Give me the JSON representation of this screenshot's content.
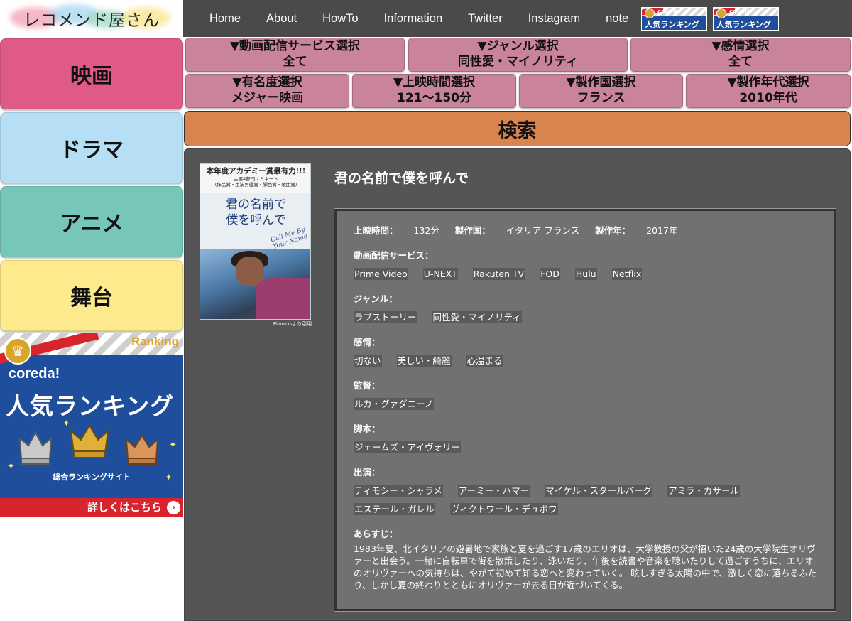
{
  "logo": {
    "text": "レコメンド屋さん"
  },
  "nav": {
    "links": [
      "Home",
      "About",
      "HowTo",
      "Information",
      "Twitter",
      "Instagram",
      "note"
    ],
    "banner_brand": "coreda!",
    "banner_title": "人気ランキング"
  },
  "sidebar": {
    "items": [
      "映画",
      "ドラマ",
      "アニメ",
      "舞台"
    ],
    "colors": [
      "#df5a86",
      "#b6def5",
      "#76c6ba",
      "#fcea8c"
    ]
  },
  "ranking_banner": {
    "ranking_label": "Ranking",
    "brand": "coreda!",
    "title": "人気ランキング",
    "subtitle": "総合ランキングサイト",
    "more": "詳しくはこちら",
    "crown_icon": "crown-icon"
  },
  "filters": [
    {
      "label": "▼動画配信サービス選択",
      "value": "全て"
    },
    {
      "label": "▼ジャンル選択",
      "value": "同性愛・マイノリティ"
    },
    {
      "label": "▼感情選択",
      "value": "全て"
    },
    {
      "label": "▼有名度選択",
      "value": "メジャー映画"
    },
    {
      "label": "▼上映時間選択",
      "value": "121〜150分"
    },
    {
      "label": "▼製作国選択",
      "value": "フランス"
    },
    {
      "label": "▼製作年代選択",
      "value": "2010年代"
    }
  ],
  "search": {
    "label": "検索",
    "color": "#d9844c"
  },
  "movie": {
    "title": "君の名前で僕を呼んで",
    "poster": {
      "top_text_1": "本年度アカデミー賞最有力!!!",
      "top_text_2": "主要4部門ノミネート",
      "top_text_3": "(作品賞・主演男優賞・脚色賞・歌曲賞)",
      "title_line_1": "君の名前で",
      "title_line_2": "僕を呼んで",
      "sub_title": "Call Me By Your Name",
      "credit": "Filmarksより引用"
    },
    "meta": {
      "runtime_label": "上映時間：",
      "runtime_value": "132分",
      "country_label": "製作国：",
      "country_value": "イタリア フランス",
      "year_label": "製作年：",
      "year_value": "2017年"
    },
    "sections": {
      "streaming_label": "動画配信サービス：",
      "streaming": [
        "Prime Video",
        "U-NEXT",
        "Rakuten TV",
        "FOD",
        "Hulu",
        "Netflix"
      ],
      "genre_label": "ジャンル：",
      "genre": [
        "ラブストーリー",
        "同性愛・マイノリティ"
      ],
      "emotion_label": "感情：",
      "emotion": [
        "切ない",
        "美しい・綺麗",
        "心温まる"
      ],
      "director_label": "監督：",
      "director": [
        "ルカ・グァダニーノ"
      ],
      "writer_label": "脚本：",
      "writer": [
        "ジェームズ・アイヴォリー"
      ],
      "cast_label": "出演：",
      "cast": [
        "ティモシー・シャラメ",
        "アーミー・ハマー",
        "マイケル・スタールバーグ",
        "アミラ・カサール",
        "エステール・ガレル",
        "ヴィクトワール・デュボワ"
      ],
      "synopsis_label": "あらすじ：",
      "synopsis": "1983年夏、北イタリアの避暑地で家族と夏を過ごす17歳のエリオは、大学教授の父が招いた24歳の大学院生オリヴァーと出会う。一緒に自転車で街を散策したり、泳いだり、午後を読書や音楽を聴いたりして過ごすうちに、エリオのオリヴァーへの気持ちは、やがて初めて知る恋へと変わっていく。 眩しすぎる太陽の中で、激しく恋に落ちるふたり、しかし夏の終わりとともにオリヴァーが去る日が近づいてくる。"
    }
  }
}
